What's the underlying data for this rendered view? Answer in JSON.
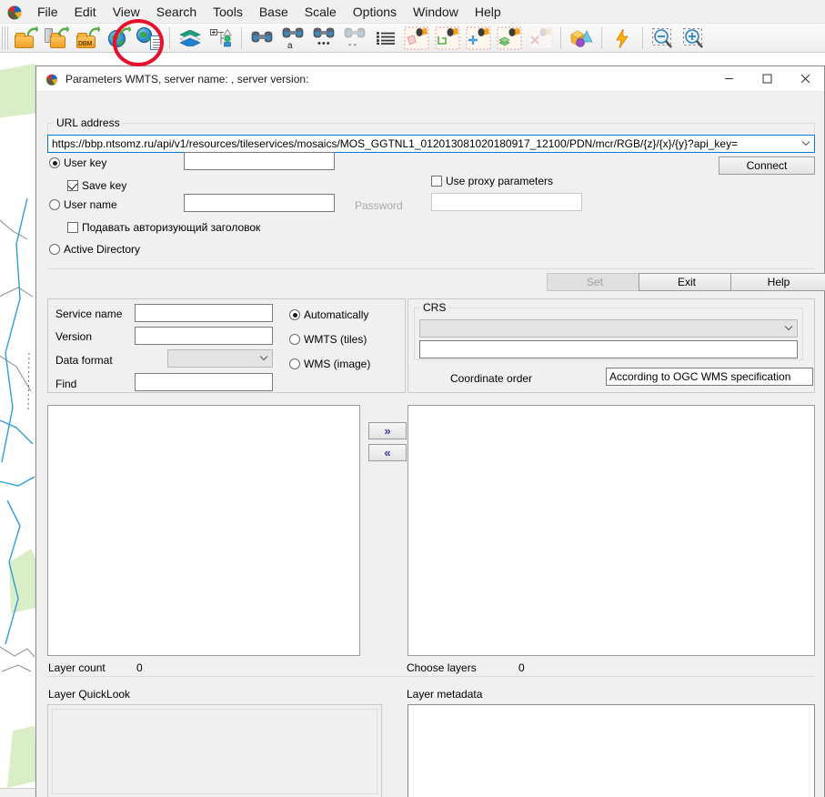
{
  "app": {
    "logo_icon": "app-logo-icon",
    "menu": [
      {
        "label": "File"
      },
      {
        "label": "Edit"
      },
      {
        "label": "View"
      },
      {
        "label": "Search"
      },
      {
        "label": "Tools"
      },
      {
        "label": "Base"
      },
      {
        "label": "Scale"
      },
      {
        "label": "Options"
      },
      {
        "label": "Window"
      },
      {
        "label": "Help"
      }
    ],
    "toolbar": [
      {
        "icon": "open-folder-icon",
        "group": 1
      },
      {
        "icon": "open-from-server-icon",
        "group": 1
      },
      {
        "icon": "open-dbm-folder-icon",
        "group": 1
      },
      {
        "icon": "open-web-service-globe-icon",
        "group": 1
      },
      {
        "icon": "open-catalog-globe-clipboard-icon",
        "group": 1
      },
      {
        "icon": "layers-icon",
        "group": 2
      },
      {
        "icon": "layer-tree-icon",
        "group": 2
      },
      {
        "icon": "search-binoculars-icon",
        "group": 3
      },
      {
        "icon": "search-text-binoculars-icon",
        "group": 3
      },
      {
        "icon": "search-more-binoculars-icon",
        "group": 3
      },
      {
        "icon": "search-area-binoculars-icon",
        "group": 3
      },
      {
        "icon": "list-icon",
        "group": 3
      },
      {
        "icon": "select-polygon-icon",
        "group": 4
      },
      {
        "icon": "select-line-icon",
        "group": 4
      },
      {
        "icon": "select-add-icon",
        "group": 4
      },
      {
        "icon": "select-stack-icon",
        "group": 4
      },
      {
        "icon": "select-remove-icon",
        "group": 4
      },
      {
        "icon": "3d-objects-icon",
        "group": 5
      },
      {
        "icon": "lightning-icon",
        "group": 6
      },
      {
        "icon": "zoom-out-icon",
        "group": 7
      },
      {
        "icon": "zoom-in-icon",
        "group": 7
      }
    ],
    "annotation": {
      "shape": "red-ellipse",
      "color": "#e8102a",
      "target_icon": "open-web-service-globe-icon"
    }
  },
  "dialog": {
    "icon": "wmts-parameters-icon",
    "title": "Parameters WMTS, server name: , server version:",
    "window_buttons": {
      "minimize": "—",
      "maximize": "☐",
      "close": "✕"
    },
    "url_group": {
      "legend": "URL address",
      "value": "https://bbp.ntsomz.ru/api/v1/resources/tileservices/mosaics/MOS_GGTNL1_012013081020180917_12100/PDN/mcr/RGB/{z}/{x}/{y}?api_key=",
      "dropdown_icon": "chevron-down-icon"
    },
    "auth": {
      "user_key": {
        "label": "User key",
        "selected": true,
        "value": ""
      },
      "save_key": {
        "label": "Save key",
        "checked": true
      },
      "user_name": {
        "label": "User name",
        "selected": false,
        "value": ""
      },
      "password": {
        "label": "Password",
        "value": "",
        "enabled": false
      },
      "auth_header": {
        "label": "Подавать авторизующий заголовок",
        "checked": false
      },
      "active_directory": {
        "label": "Active Directory",
        "selected": false
      },
      "use_proxy": {
        "label": "Use proxy parameters",
        "checked": false
      },
      "proxy_value": "",
      "connect_button": "Connect"
    },
    "action_buttons": {
      "set": {
        "label": "Set",
        "enabled": false
      },
      "exit": {
        "label": "Exit",
        "enabled": true
      },
      "help": {
        "label": "Help",
        "enabled": true
      }
    },
    "service": {
      "service_name": {
        "label": "Service name",
        "value": ""
      },
      "version": {
        "label": "Version",
        "value": ""
      },
      "data_format": {
        "label": "Data format",
        "value": "",
        "enabled": false,
        "icon": "chevron-down-icon"
      },
      "find": {
        "label": "Find",
        "value": ""
      },
      "mode": {
        "automatically": {
          "label": "Automatically",
          "selected": true
        },
        "wmts_tiles": {
          "label": "WMTS (tiles)",
          "selected": false
        },
        "wms_image": {
          "label": "WMS  (image)",
          "selected": false
        }
      }
    },
    "crs": {
      "legend": "CRS",
      "combo_value": "",
      "combo_enabled": false,
      "combo_icon": "chevron-down-icon",
      "text_value": "",
      "coordinate_order_label": "Coordinate order",
      "coordinate_order_value": "According to OGC WMS specification"
    },
    "layers": {
      "transfer_right": {
        "label": "»",
        "name": "move-right-button"
      },
      "transfer_left": {
        "label": "«",
        "name": "move-left-button"
      },
      "available_items": [],
      "chosen_items": [],
      "layer_count_label": "Layer count",
      "layer_count_value": "0",
      "choose_layers_label": "Choose layers",
      "choose_layers_value": "0",
      "quicklook_label": "Layer QuickLook",
      "metadata_label": "Layer metadata",
      "quicklook_content": "",
      "metadata_content": ""
    }
  },
  "colors": {
    "accent_blue": "#0078d7",
    "annotation_red": "#e8102a",
    "dialog_bg": "#f0f0f0",
    "map_green": "#d4ecc3",
    "map_water": "#2f8fd0"
  }
}
